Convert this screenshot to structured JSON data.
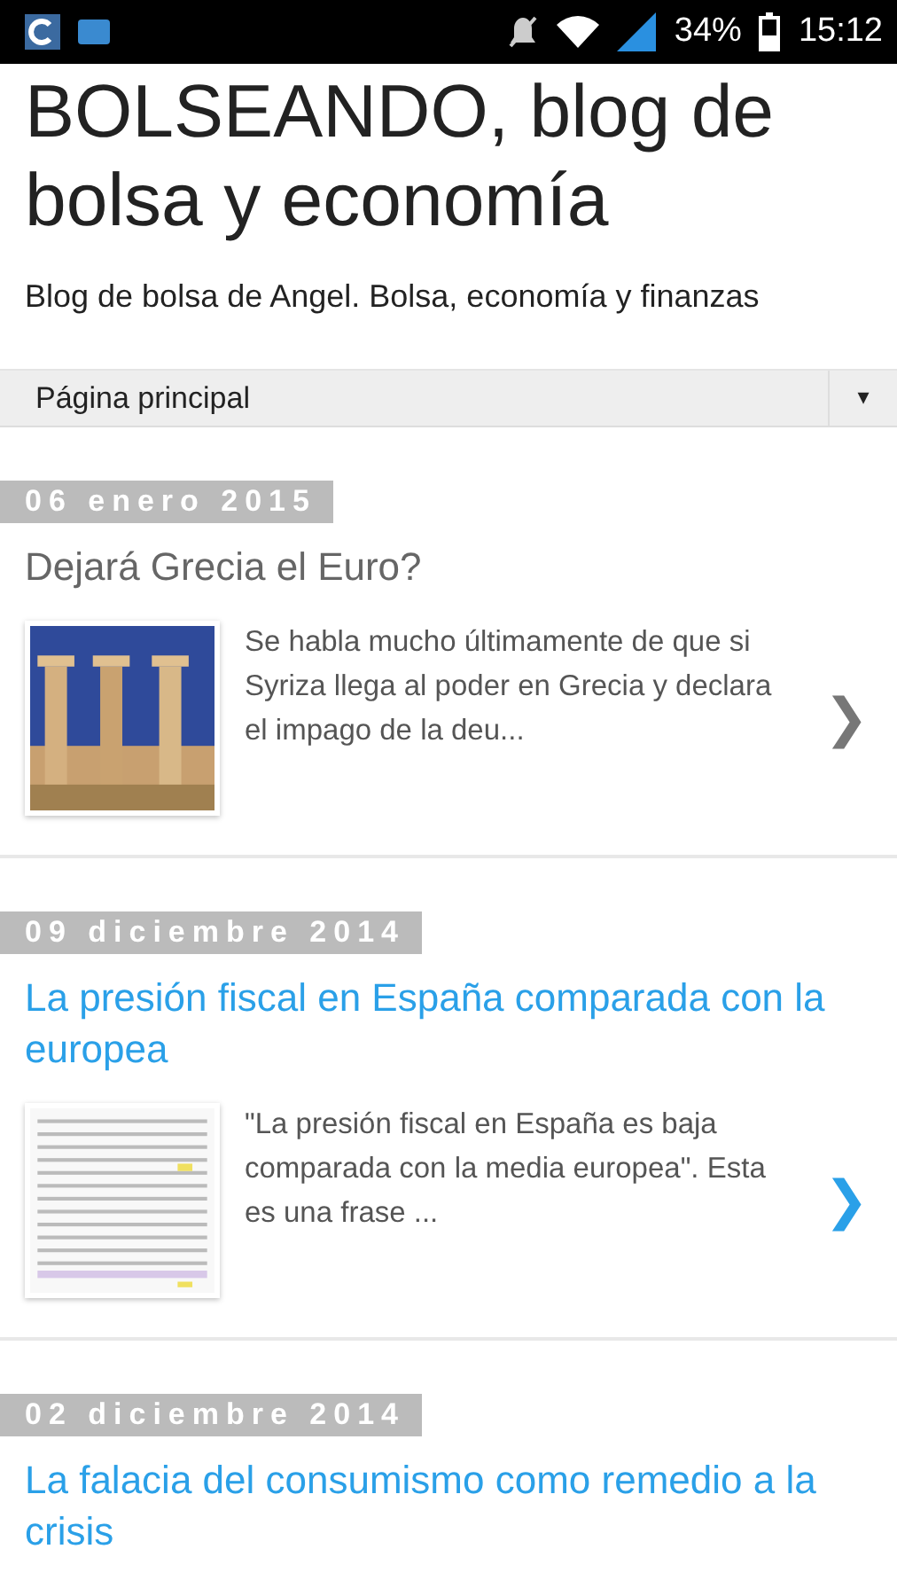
{
  "status_bar": {
    "battery": "34%",
    "time": "15:12"
  },
  "blog": {
    "title": "BOLSEANDO, blog de bolsa y economía",
    "description": "Blog de bolsa de Angel. Bolsa, economía y finanzas"
  },
  "page_menu": {
    "value": "Página principal",
    "arrow": "▾"
  },
  "posts": [
    {
      "date": "06 enero 2015",
      "title": "Dejará Grecia el Euro?",
      "visited": true,
      "excerpt": "Se habla mucho últimamente de que si Syriza llega al poder en Grecia y declara el impago de la deu...",
      "chevron": "❯"
    },
    {
      "date": "09 diciembre 2014",
      "title": "La presión fiscal en España comparada con la europea",
      "visited": false,
      "thumbnail": {
        "kind": "table"
      },
      "excerpt": "\"La presión fiscal en España es baja comparada con la media europea\". Esta es una frase ...",
      "chevron": "❯"
    },
    {
      "date": "02 diciembre 2014",
      "title": "La falacia del consumismo como remedio a la crisis",
      "visited": false
    }
  ]
}
